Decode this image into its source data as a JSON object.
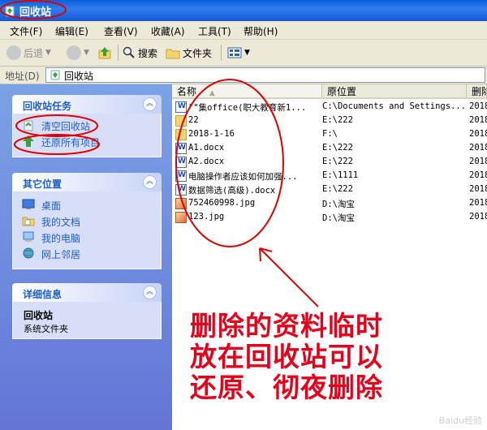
{
  "window": {
    "title": "回收站"
  },
  "menu": [
    "文件(F)",
    "编辑(E)",
    "查看(V)",
    "收藏(A)",
    "工具(T)",
    "帮助(H)"
  ],
  "toolbar": {
    "back": "后退",
    "search": "搜索",
    "folders": "文件夹"
  },
  "address": {
    "label": "地址(D)",
    "value": "回收站"
  },
  "tasks_panel": {
    "title": "回收站任务",
    "items": [
      "清空回收站",
      "还原所有项目"
    ]
  },
  "places_panel": {
    "title": "其它位置",
    "items": [
      "桌面",
      "我的文档",
      "我的电脑",
      "网上邻居"
    ]
  },
  "details_panel": {
    "title": "详细信息",
    "name": "回收站",
    "type": "系统文件夹"
  },
  "columns": {
    "name": "名称",
    "location": "原位置",
    "date": "删除"
  },
  "files": [
    {
      "name": "\"\"集office(职大教育新1...",
      "location": "C:\\Documents and Settings...",
      "date": "2018",
      "icon": "doc-icon"
    },
    {
      "name": "22",
      "location": "E:\\222",
      "date": "2018",
      "icon": "folder-icon"
    },
    {
      "name": "2018-1-16",
      "location": "F:\\",
      "date": "2018",
      "icon": "folder-icon"
    },
    {
      "name": "A1.docx",
      "location": "E:\\222",
      "date": "2018",
      "icon": "doc-icon"
    },
    {
      "name": "A2.docx",
      "location": "E:\\222",
      "date": "2018",
      "icon": "doc-icon"
    },
    {
      "name": "电脑操作者应该如何加强...",
      "location": "E:\\1111",
      "date": "2018",
      "icon": "doc-icon"
    },
    {
      "name": "数据筛选(高级).docx",
      "location": "E:\\222",
      "date": "2018",
      "icon": "doc-icon"
    },
    {
      "name": "752460998.jpg",
      "location": "D:\\淘宝",
      "date": "2018",
      "icon": "image-icon"
    },
    {
      "name": "123.jpg",
      "location": "D:\\淘宝",
      "date": "2018",
      "icon": "image-icon"
    }
  ],
  "annotation": [
    "删除的资料临时",
    "放在回收站可以",
    "还原、彻夜删除"
  ],
  "watermark": "Baidu经验",
  "colors": {
    "annotation": "#e6001a",
    "link": "#215dc6",
    "titlebar": "#0a5fd8"
  }
}
